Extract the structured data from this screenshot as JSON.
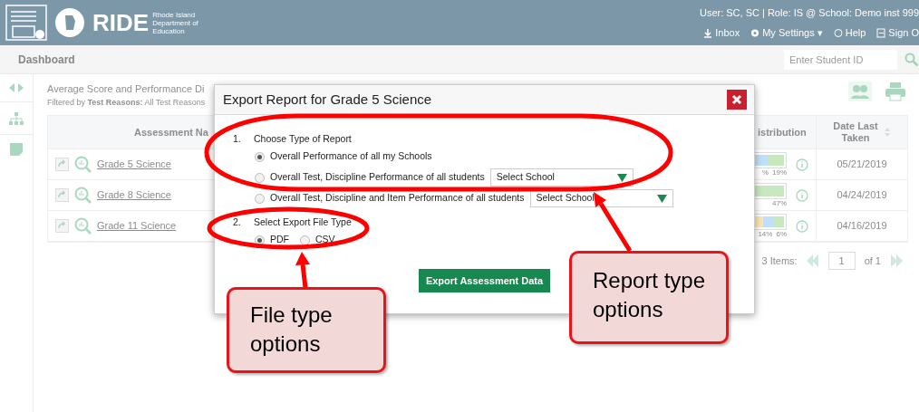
{
  "header": {
    "brand": "RIDE",
    "brand_sub": "Rhode Island Department of Education",
    "user_info": "User: SC, SC  |  Role: IS @ School: Demo inst 999",
    "links": [
      "Inbox",
      "My Settings ▾",
      "Help",
      "Sign O"
    ]
  },
  "nav": {
    "title": "Dashboard",
    "search": {
      "placeholder": "Enter Student ID"
    }
  },
  "report": {
    "title": "Average Score and Performance Di",
    "filter": "Filtered by **Test Reasons:** All Test Reasons",
    "columns": [
      "Assessment Na",
      "istribution",
      "Date Last Taken"
    ],
    "rows": [
      {
        "name": "Grade 5 Science",
        "segments": [
          {
            "color": "#bfe0f7"
          },
          {
            "color": "#c8e8bf"
          }
        ],
        "labels": [
          "%",
          "19%"
        ],
        "date": "05/21/2019"
      },
      {
        "name": "Grade 8 Science",
        "segments": [
          {
            "color": "#c8e8bf"
          }
        ],
        "labels": [
          "47%"
        ],
        "date": "04/24/2019"
      },
      {
        "name": "Grade 11 Science",
        "segments": [
          {
            "color": "#fbe6b5"
          },
          {
            "color": "#bfe0f7"
          },
          {
            "color": "#c8e8bf"
          }
        ],
        "labels": [
          "14%",
          "6%"
        ],
        "date": "04/16/2019"
      }
    ],
    "pagination": {
      "items": "3 Items:",
      "page": "1",
      "of": "of 1"
    }
  },
  "modal": {
    "title": "Export Report for Grade 5 Science",
    "steps": [
      {
        "kind": "list",
        "number": "1.",
        "label": "Choose Type of Report",
        "options": [
          {
            "label": "Overall Performance of all my Schools",
            "selected": true
          },
          {
            "label": "Overall Test, Discipline Performance of all students",
            "selected": false,
            "dropdown": "Select School"
          },
          {
            "label": "Overall Test, Discipline and Item Performance of all students",
            "selected": false,
            "dropdown": "Select School"
          }
        ]
      },
      {
        "kind": "row",
        "number": "2.",
        "label": "Select Export File Type",
        "options": [
          {
            "label": "PDF",
            "selected": true
          },
          {
            "label": "CSV",
            "selected": false
          }
        ]
      }
    ],
    "button": "Export Assessment Data"
  },
  "callouts": [
    "File type options",
    "Report type options"
  ]
}
